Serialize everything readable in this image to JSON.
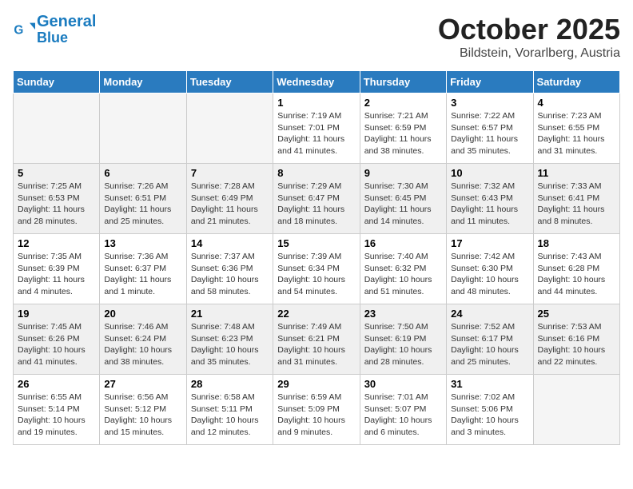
{
  "header": {
    "logo_line1": "General",
    "logo_line2": "Blue",
    "month": "October 2025",
    "location": "Bildstein, Vorarlberg, Austria"
  },
  "weekdays": [
    "Sunday",
    "Monday",
    "Tuesday",
    "Wednesday",
    "Thursday",
    "Friday",
    "Saturday"
  ],
  "weeks": [
    [
      {
        "day": "",
        "info": ""
      },
      {
        "day": "",
        "info": ""
      },
      {
        "day": "",
        "info": ""
      },
      {
        "day": "1",
        "info": "Sunrise: 7:19 AM\nSunset: 7:01 PM\nDaylight: 11 hours and 41 minutes."
      },
      {
        "day": "2",
        "info": "Sunrise: 7:21 AM\nSunset: 6:59 PM\nDaylight: 11 hours and 38 minutes."
      },
      {
        "day": "3",
        "info": "Sunrise: 7:22 AM\nSunset: 6:57 PM\nDaylight: 11 hours and 35 minutes."
      },
      {
        "day": "4",
        "info": "Sunrise: 7:23 AM\nSunset: 6:55 PM\nDaylight: 11 hours and 31 minutes."
      }
    ],
    [
      {
        "day": "5",
        "info": "Sunrise: 7:25 AM\nSunset: 6:53 PM\nDaylight: 11 hours and 28 minutes."
      },
      {
        "day": "6",
        "info": "Sunrise: 7:26 AM\nSunset: 6:51 PM\nDaylight: 11 hours and 25 minutes."
      },
      {
        "day": "7",
        "info": "Sunrise: 7:28 AM\nSunset: 6:49 PM\nDaylight: 11 hours and 21 minutes."
      },
      {
        "day": "8",
        "info": "Sunrise: 7:29 AM\nSunset: 6:47 PM\nDaylight: 11 hours and 18 minutes."
      },
      {
        "day": "9",
        "info": "Sunrise: 7:30 AM\nSunset: 6:45 PM\nDaylight: 11 hours and 14 minutes."
      },
      {
        "day": "10",
        "info": "Sunrise: 7:32 AM\nSunset: 6:43 PM\nDaylight: 11 hours and 11 minutes."
      },
      {
        "day": "11",
        "info": "Sunrise: 7:33 AM\nSunset: 6:41 PM\nDaylight: 11 hours and 8 minutes."
      }
    ],
    [
      {
        "day": "12",
        "info": "Sunrise: 7:35 AM\nSunset: 6:39 PM\nDaylight: 11 hours and 4 minutes."
      },
      {
        "day": "13",
        "info": "Sunrise: 7:36 AM\nSunset: 6:37 PM\nDaylight: 11 hours and 1 minute."
      },
      {
        "day": "14",
        "info": "Sunrise: 7:37 AM\nSunset: 6:36 PM\nDaylight: 10 hours and 58 minutes."
      },
      {
        "day": "15",
        "info": "Sunrise: 7:39 AM\nSunset: 6:34 PM\nDaylight: 10 hours and 54 minutes."
      },
      {
        "day": "16",
        "info": "Sunrise: 7:40 AM\nSunset: 6:32 PM\nDaylight: 10 hours and 51 minutes."
      },
      {
        "day": "17",
        "info": "Sunrise: 7:42 AM\nSunset: 6:30 PM\nDaylight: 10 hours and 48 minutes."
      },
      {
        "day": "18",
        "info": "Sunrise: 7:43 AM\nSunset: 6:28 PM\nDaylight: 10 hours and 44 minutes."
      }
    ],
    [
      {
        "day": "19",
        "info": "Sunrise: 7:45 AM\nSunset: 6:26 PM\nDaylight: 10 hours and 41 minutes."
      },
      {
        "day": "20",
        "info": "Sunrise: 7:46 AM\nSunset: 6:24 PM\nDaylight: 10 hours and 38 minutes."
      },
      {
        "day": "21",
        "info": "Sunrise: 7:48 AM\nSunset: 6:23 PM\nDaylight: 10 hours and 35 minutes."
      },
      {
        "day": "22",
        "info": "Sunrise: 7:49 AM\nSunset: 6:21 PM\nDaylight: 10 hours and 31 minutes."
      },
      {
        "day": "23",
        "info": "Sunrise: 7:50 AM\nSunset: 6:19 PM\nDaylight: 10 hours and 28 minutes."
      },
      {
        "day": "24",
        "info": "Sunrise: 7:52 AM\nSunset: 6:17 PM\nDaylight: 10 hours and 25 minutes."
      },
      {
        "day": "25",
        "info": "Sunrise: 7:53 AM\nSunset: 6:16 PM\nDaylight: 10 hours and 22 minutes."
      }
    ],
    [
      {
        "day": "26",
        "info": "Sunrise: 6:55 AM\nSunset: 5:14 PM\nDaylight: 10 hours and 19 minutes."
      },
      {
        "day": "27",
        "info": "Sunrise: 6:56 AM\nSunset: 5:12 PM\nDaylight: 10 hours and 15 minutes."
      },
      {
        "day": "28",
        "info": "Sunrise: 6:58 AM\nSunset: 5:11 PM\nDaylight: 10 hours and 12 minutes."
      },
      {
        "day": "29",
        "info": "Sunrise: 6:59 AM\nSunset: 5:09 PM\nDaylight: 10 hours and 9 minutes."
      },
      {
        "day": "30",
        "info": "Sunrise: 7:01 AM\nSunset: 5:07 PM\nDaylight: 10 hours and 6 minutes."
      },
      {
        "day": "31",
        "info": "Sunrise: 7:02 AM\nSunset: 5:06 PM\nDaylight: 10 hours and 3 minutes."
      },
      {
        "day": "",
        "info": ""
      }
    ]
  ]
}
